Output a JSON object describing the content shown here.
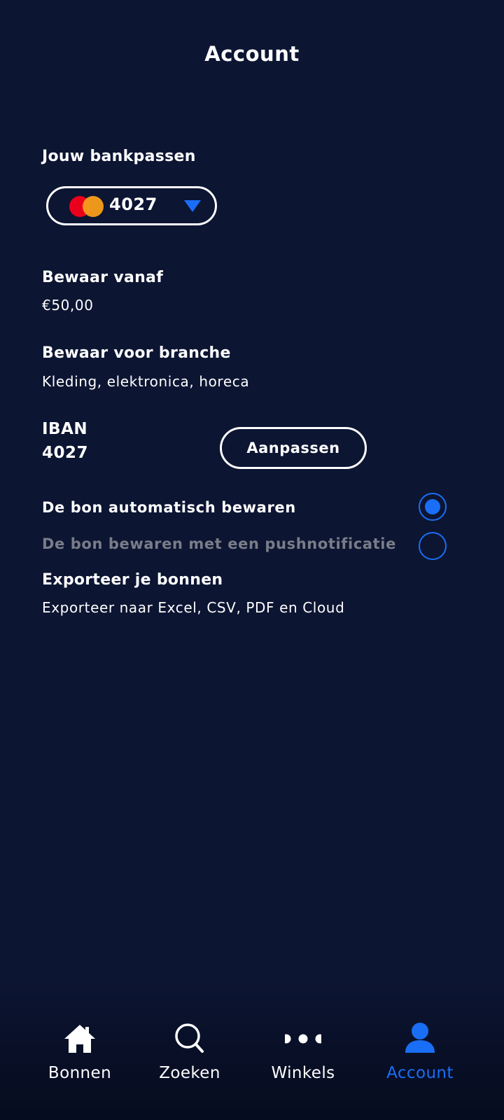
{
  "header": {
    "title": "Account"
  },
  "cards": {
    "heading": "Jouw bankpassen",
    "selected_last4": "4027",
    "brand_icon": "mastercard-icon"
  },
  "save_from": {
    "heading": "Bewaar vanaf",
    "value": "€50,00"
  },
  "save_branch": {
    "heading": "Bewaar voor branche",
    "value": "Kleding, elektronica, horeca"
  },
  "iban": {
    "label": "IBAN",
    "value": "4027",
    "edit_label": "Aanpassen"
  },
  "receipt_options": {
    "auto_save": {
      "label": "De bon automatisch bewaren",
      "selected": true
    },
    "push_save": {
      "label": "De bon bewaren met een pushnotificatie",
      "selected": false
    }
  },
  "export": {
    "heading": "Exporteer je bonnen",
    "value": "Exporteer naar Excel, CSV, PDF en Cloud"
  },
  "nav": {
    "items": [
      {
        "label": "Bonnen",
        "icon": "home-icon",
        "active": false
      },
      {
        "label": "Zoeken",
        "icon": "search-icon",
        "active": false
      },
      {
        "label": "Winkels",
        "icon": "more-dots-icon",
        "active": false
      },
      {
        "label": "Account",
        "icon": "user-icon",
        "active": true
      }
    ]
  },
  "colors": {
    "background": "#0c1532",
    "accent": "#1a6ef5",
    "disabled_text": "#7a7d89",
    "mastercard_red": "#eb001b",
    "mastercard_orange": "#f79e1b"
  }
}
